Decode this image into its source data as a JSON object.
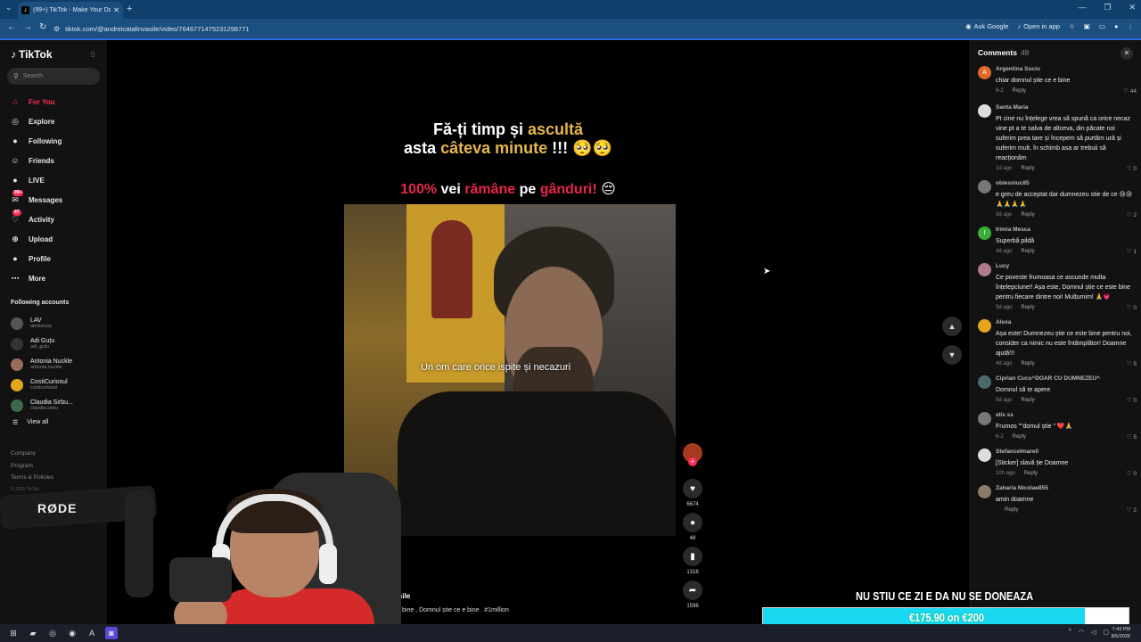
{
  "browser": {
    "tab_title": "(99+) TikTok - Make Your Day",
    "url": "tiktok.com/@andreicatalinvasile/video/7646771475231296771",
    "ask_google": "Ask Google",
    "open_in_app": "Open in app"
  },
  "sidebar": {
    "logo": "TikTok",
    "search_placeholder": "Search",
    "nav": [
      {
        "label": "For You",
        "icon": "home-icon",
        "badge": ""
      },
      {
        "label": "Explore",
        "icon": "compass-icon",
        "badge": ""
      },
      {
        "label": "Following",
        "icon": "following-icon",
        "badge": ""
      },
      {
        "label": "Friends",
        "icon": "friends-icon",
        "badge": ""
      },
      {
        "label": "LIVE",
        "icon": "live-icon",
        "badge": ""
      },
      {
        "label": "Messages",
        "icon": "messages-icon",
        "badge": "99+"
      },
      {
        "label": "Activity",
        "icon": "activity-icon",
        "badge": "47"
      },
      {
        "label": "Upload",
        "icon": "upload-icon",
        "badge": ""
      },
      {
        "label": "Profile",
        "icon": "profile-icon",
        "badge": ""
      },
      {
        "label": "More",
        "icon": "more-icon",
        "badge": ""
      }
    ],
    "following_title": "Following accounts",
    "accounts": [
      {
        "name": "LAV",
        "handle": "alexlavsw",
        "color": "#555"
      },
      {
        "name": "Adi Guțu",
        "handle": "adi_gutu",
        "color": "#333"
      },
      {
        "name": "Antonia Nuckle",
        "handle": "antonia.nuckle",
        "color": "#9a6a5a"
      },
      {
        "name": "CostiCuriosul",
        "handle": "costicuriosul",
        "color": "#e5a61e"
      },
      {
        "name": "Claudia Sirbu...",
        "handle": "claudia.sirbu",
        "color": "#3a6a4a"
      }
    ],
    "view_all": "View all",
    "footer": [
      "Company",
      "Program",
      "Terms & Policies"
    ],
    "copyright": "© 2026 TikTok"
  },
  "video": {
    "caption_line1_a": "Fă-ți timp și ",
    "caption_line1_b": "ascultă",
    "caption_line2_a": "asta ",
    "caption_line2_b": "câteva minute",
    "caption_line2_c": " !!! 🥺🥺",
    "caption3_a": "100%",
    "caption3_b": " vei ",
    "caption3_c": "rămâne",
    "caption3_d": " pe ",
    "caption3_e": "gânduri!",
    "caption3_f": " 😔",
    "subtitle": "Un om care orice ispite și necazuri",
    "likes": "6674",
    "comments": "48",
    "saves": "1316",
    "shares": "1596",
    "author": "vasile",
    "description": "arte bine , Domnul știe ce e bine . #1million"
  },
  "comments": {
    "title": "Comments",
    "count": "48",
    "items": [
      {
        "user": "Argentina Suciu",
        "text": "chiar domnul știe ce e bine",
        "time": "6-2",
        "likes": "44",
        "color": "#e06a2a",
        "initial": "A"
      },
      {
        "user": "Santa Maria",
        "text": "Pt cine nu înțelege vrea să spună ca orice necaz vine pt a te salva de altceva, din păcate noi suferim prea tare și începem să purtăm ură și suferim mult, în schimb asa ar trebuii să reacționăm",
        "time": "1d ago",
        "likes": "0",
        "color": "#ddd",
        "initial": ""
      },
      {
        "user": "oblesniuc85",
        "text": "e greu de acceptat dar dumnezeu stie de ce 😢😢🙏🙏🙏🙏",
        "time": "3d ago",
        "likes": "2",
        "color": "#777",
        "initial": ""
      },
      {
        "user": "Irimia Mesca",
        "text": "Superbă pildă",
        "time": "4d ago",
        "likes": "1",
        "color": "#3ab03a",
        "initial": "I"
      },
      {
        "user": "Lucy",
        "text": "Ce poveste frumoasa ce ascunde multa înțelepciune!! Așa este, Domnul știe ce este bine pentru fiecare dintre noi! Mulțumim! 🙏💗",
        "time": "3d ago",
        "likes": "0",
        "color": "#b07a8a",
        "initial": ""
      },
      {
        "user": "Alexa",
        "text": "Așa este! Dumnezeu știe ce este bine pentru noi, consider ca nimic nu este întâmplător! Doamne ajută!!!",
        "time": "4d ago",
        "likes": "5",
        "color": "#e5a61e",
        "initial": ""
      },
      {
        "user": "Ciprian Cucu^DOAR CU DUMNEZEU^",
        "text": "Domnul să te apere",
        "time": "5d ago",
        "likes": "0",
        "color": "#4a6a6a",
        "initial": ""
      },
      {
        "user": "elis ss",
        "text": "Frumos \"\"domul știe \" ❤️🙏",
        "time": "6-2",
        "likes": "5",
        "color": "#777",
        "initial": ""
      },
      {
        "user": "Stefancelmare0",
        "text": "[Sticker] slavă ție Doamne",
        "time": "10h ago",
        "likes": "0",
        "color": "#ddd",
        "initial": ""
      },
      {
        "user": "Zaharia Nicolae855",
        "text": "amin doamne",
        "time": "",
        "likes": "2",
        "color": "#8a7a6a",
        "initial": ""
      }
    ],
    "reply_label": "Reply"
  },
  "donation": {
    "title": "NU STIU CE ZI E DA NU SE DONEAZA",
    "amount": "€175.90 on €200",
    "progress": 0.88
  },
  "taskbar": {
    "time": "7:43 PM",
    "date": "8/5/2026"
  }
}
